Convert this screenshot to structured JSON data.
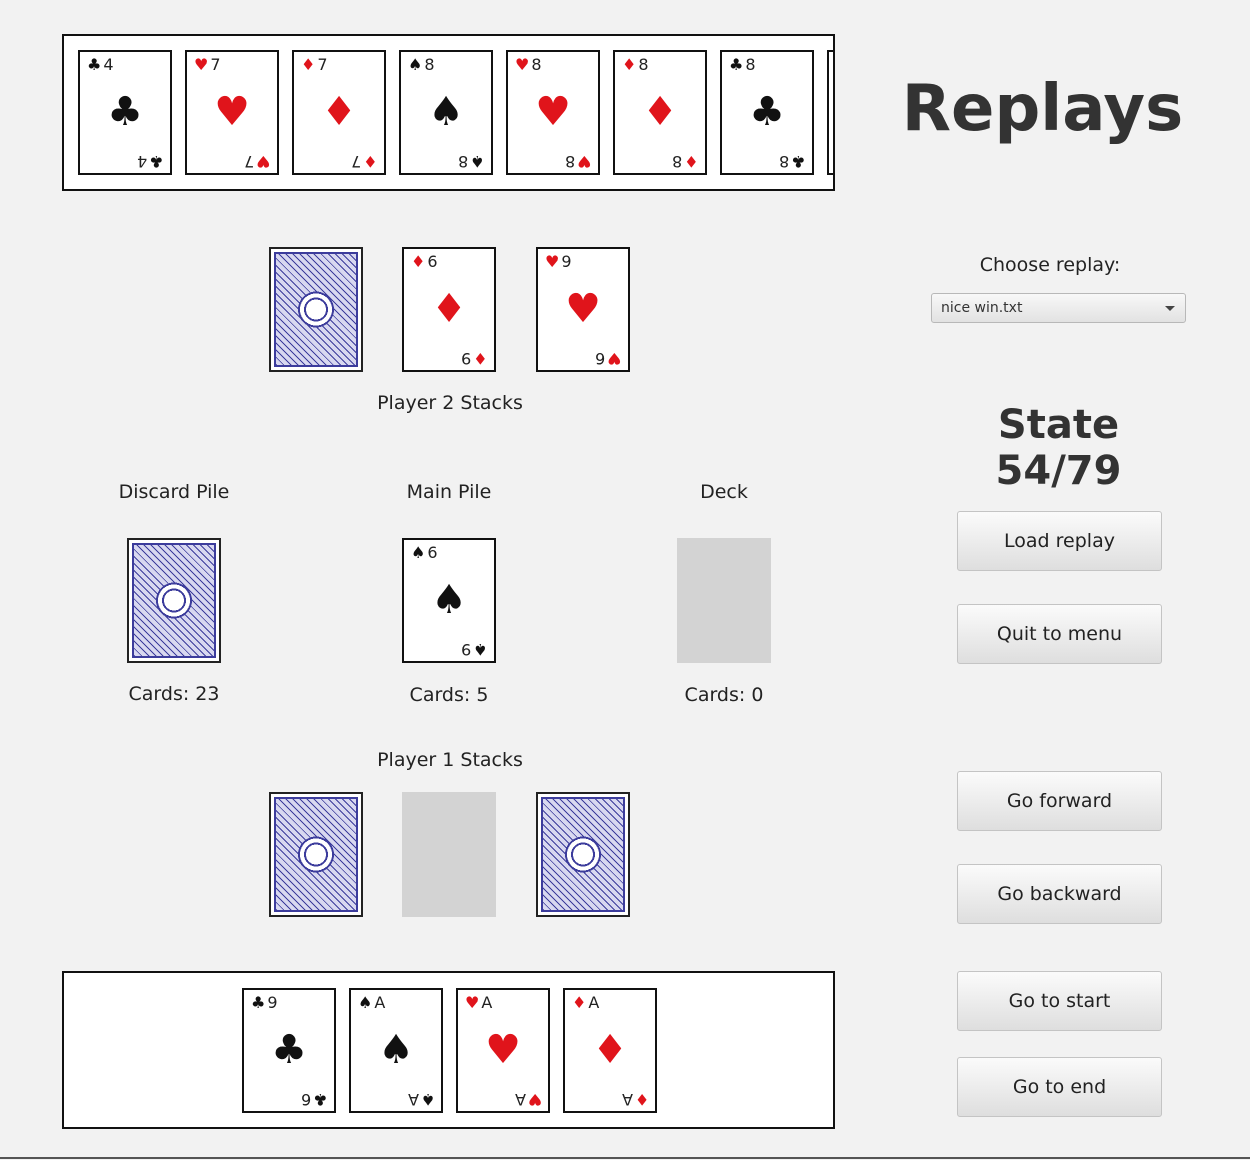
{
  "title": "Replays",
  "choose_replay": {
    "label": "Choose replay:",
    "selected": "nice win.txt"
  },
  "state": "State 54/79",
  "buttons": {
    "load_replay": "Load replay",
    "quit_to_menu": "Quit to menu",
    "go_forward": "Go forward",
    "go_backward": "Go backward",
    "go_to_start": "Go to start",
    "go_to_end": "Go to end"
  },
  "opponent_hand": [
    {
      "rank": "4",
      "suit": "♣",
      "color": "black"
    },
    {
      "rank": "7",
      "suit": "♥",
      "color": "red"
    },
    {
      "rank": "7",
      "suit": "♦",
      "color": "red"
    },
    {
      "rank": "8",
      "suit": "♠",
      "color": "black"
    },
    {
      "rank": "8",
      "suit": "♥",
      "color": "red"
    },
    {
      "rank": "8",
      "suit": "♦",
      "color": "red"
    },
    {
      "rank": "8",
      "suit": "♣",
      "color": "black"
    }
  ],
  "player2_stacks": {
    "label": "Player 2 Stacks",
    "cards": [
      {
        "face": "back"
      },
      {
        "rank": "6",
        "suit": "♦",
        "color": "red",
        "bottom_rank": "9"
      },
      {
        "rank": "9",
        "suit": "♥",
        "color": "red",
        "bottom_rank": "6"
      }
    ]
  },
  "discard_pile": {
    "label": "Discard Pile",
    "count": "Cards: 23"
  },
  "main_pile": {
    "label": "Main Pile",
    "count": "Cards: 5",
    "top": {
      "rank": "6",
      "suit": "♠",
      "color": "black",
      "bottom_rank": "9"
    }
  },
  "deck": {
    "label": "Deck",
    "count": "Cards: 0"
  },
  "player1_stacks": {
    "label": "Player 1 Stacks",
    "cards": [
      {
        "face": "back"
      },
      {
        "face": "empty"
      },
      {
        "face": "back"
      }
    ]
  },
  "my_hand": [
    {
      "rank": "9",
      "suit": "♣",
      "color": "black",
      "bottom_rank": "6"
    },
    {
      "rank": "A",
      "suit": "♠",
      "color": "black",
      "bottom_rank": "A"
    },
    {
      "rank": "A",
      "suit": "♥",
      "color": "red",
      "bottom_rank": "A"
    },
    {
      "rank": "A",
      "suit": "♦",
      "color": "red",
      "bottom_rank": "A"
    }
  ]
}
